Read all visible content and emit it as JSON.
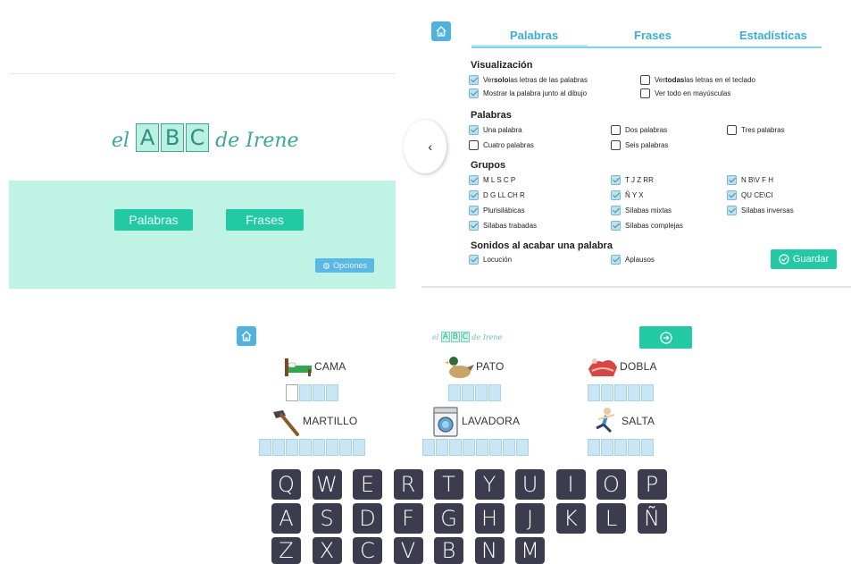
{
  "home": {
    "logo": {
      "el": "el",
      "letters": [
        "A",
        "B",
        "C"
      ],
      "de_irene": "de Irene"
    },
    "buttons": {
      "palabras": "Palabras",
      "frases": "Frases"
    },
    "opciones": "Opciones"
  },
  "settings": {
    "tabs": [
      "Palabras",
      "Frases",
      "Estadísticas"
    ],
    "visualizacion": {
      "title": "Visualización",
      "options": [
        {
          "pre": "Ver ",
          "bold": "solo",
          "post": " las letras de las palabras",
          "checked": true
        },
        {
          "pre": "Ver ",
          "bold": "todas",
          "post": " las letras en el teclado",
          "checked": false
        },
        {
          "pre": "Mostrar la palabra junto al dibujo",
          "bold": "",
          "post": "",
          "checked": true
        },
        {
          "pre": "Ver todo en mayúsculas",
          "bold": "",
          "post": "",
          "checked": false
        }
      ]
    },
    "palabras": {
      "title": "Palabras",
      "options": [
        {
          "label": "Una palabra",
          "checked": true
        },
        {
          "label": "Dos palabras",
          "checked": false
        },
        {
          "label": "Tres palabras",
          "checked": false
        },
        {
          "label": "Cuatro palabras",
          "checked": false
        },
        {
          "label": "Seis palabras",
          "checked": false
        }
      ]
    },
    "grupos": {
      "title": "Grupos",
      "options": [
        {
          "label": "M L S C P",
          "checked": true
        },
        {
          "label": "T J Z RR",
          "checked": true
        },
        {
          "label": "N B\\V F H",
          "checked": true
        },
        {
          "label": "D G LL CH R",
          "checked": true
        },
        {
          "label": "Ñ Y X",
          "checked": true
        },
        {
          "label": "QU CE\\CI",
          "checked": true
        },
        {
          "label": "Plurisilábicas",
          "checked": true
        },
        {
          "label": "Sílabas mixtas",
          "checked": true
        },
        {
          "label": "Sílabas inversas",
          "checked": true
        },
        {
          "label": "Sílabas trabadas",
          "checked": true
        },
        {
          "label": "Sílabas complejas",
          "checked": true
        }
      ]
    },
    "sonidos": {
      "title": "Sonidos al acabar una palabra",
      "options": [
        {
          "label": "Locución",
          "checked": true
        },
        {
          "label": "Aplausos",
          "checked": true
        }
      ]
    },
    "guardar": "Guardar",
    "back_arrow": "‹"
  },
  "game": {
    "logo": {
      "el": "el",
      "letters": [
        "A",
        "B",
        "C"
      ],
      "de_irene": "de Irene"
    },
    "words": [
      {
        "word": "CAMA",
        "icon": "bed-icon",
        "slots": 4
      },
      {
        "word": "PATO",
        "icon": "duck-icon",
        "slots": 4
      },
      {
        "word": "DOBLA",
        "icon": "folding-clothes-icon",
        "slots": 5
      },
      {
        "word": "MARTILLO",
        "icon": "hammer-icon",
        "slots": 8
      },
      {
        "word": "LAVADORA",
        "icon": "washing-machine-icon",
        "slots": 8
      },
      {
        "word": "SALTA",
        "icon": "jumping-person-icon",
        "slots": 5
      }
    ],
    "keyboard": [
      [
        "Q",
        "W",
        "E",
        "R",
        "T",
        "Y",
        "U",
        "I",
        "O",
        "P"
      ],
      [
        "A",
        "S",
        "D",
        "F",
        "G",
        "H",
        "J",
        "K",
        "L",
        "Ñ"
      ],
      [
        "Z",
        "X",
        "C",
        "V",
        "B",
        "N",
        "M"
      ]
    ]
  },
  "colors": {
    "mint": "#bff3e4",
    "green_button": "#22c9a4",
    "blue": "#4fb3dd",
    "key": "#3d3b4e"
  }
}
